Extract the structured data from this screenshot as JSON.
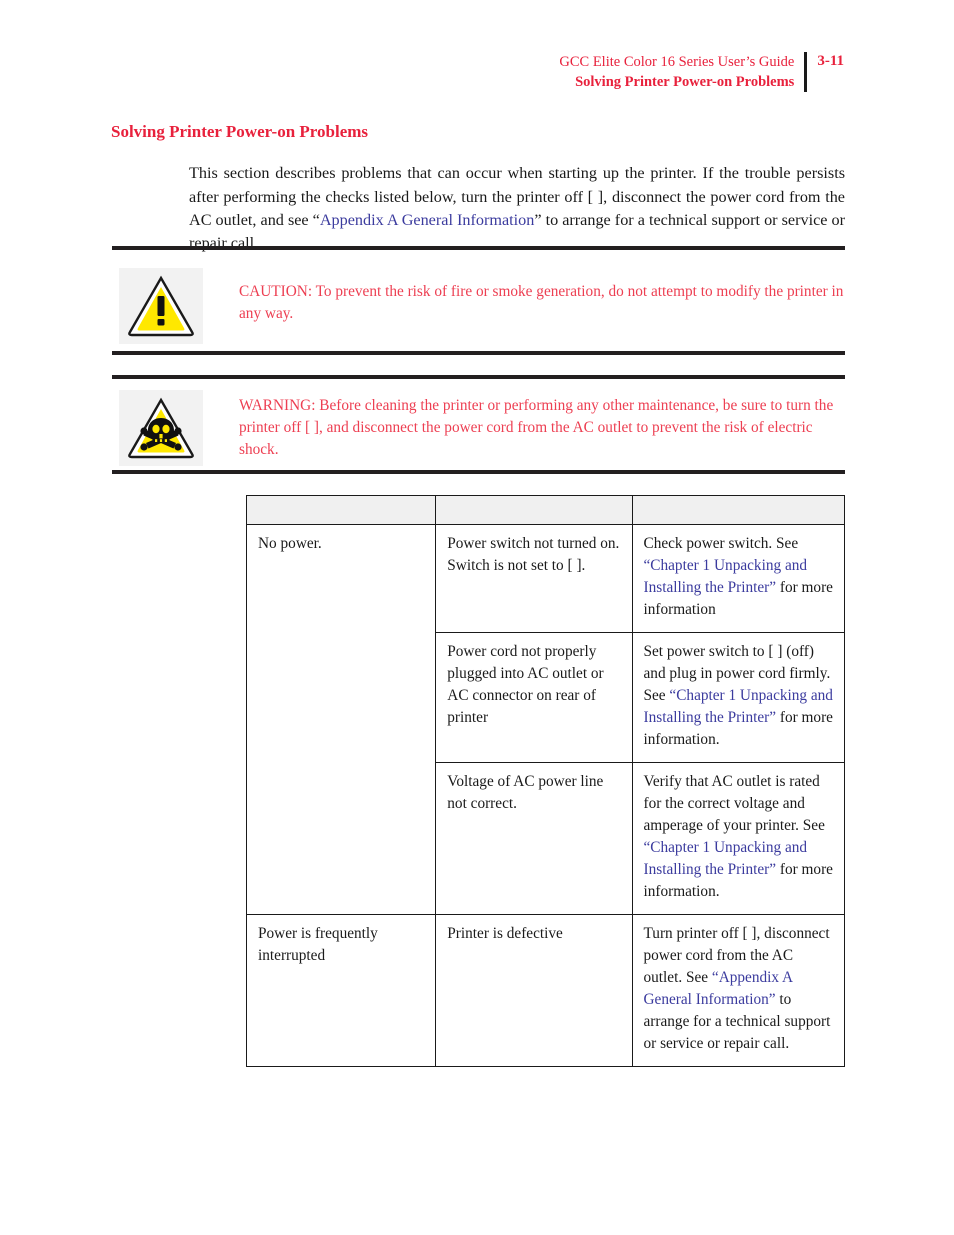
{
  "header": {
    "guide_title": "GCC Elite Color 16 Series User’s Guide",
    "section_title": "Solving Printer Power-on Problems",
    "page_number": "3-11"
  },
  "section": {
    "title": "Solving Printer Power-on Problems",
    "intro_part1": "This section describes problems that can occur when starting up the printer. If the trouble persists after performing the checks listed below, turn the printer off [    ], disconnect the power cord from the AC outlet, and see “",
    "intro_link": "Appendix A General Information",
    "intro_part2": "”  to arrange for a technical support or service or repair call."
  },
  "caution": {
    "icon": "warning-triangle-exclamation-icon",
    "text": "CAUTION: To prevent the risk of fire or smoke generation, do not attempt to modify the printer in any way."
  },
  "warning": {
    "icon": "warning-triangle-skull-icon",
    "text": "WARNING: Before cleaning the printer or performing any other maintenance, be sure to turn the printer off [     ], and disconnect the power cord from the AC outlet to prevent the risk of electric shock."
  },
  "table": {
    "headers": [
      "",
      "",
      ""
    ],
    "rows": [
      {
        "symptom": "No power.",
        "cause": "Power switch not turned on. Switch is not set to [   ].",
        "remedy_pre": "Check power switch. See ",
        "remedy_link": "“Chapter 1 Unpacking and Installing the Printer”",
        "remedy_post": " for more information"
      },
      {
        "symptom": "",
        "cause": "Power cord not properly plugged into AC outlet or AC connector on rear of printer",
        "remedy_pre": "Set power switch to [     ] (off) and plug in power cord firmly. See ",
        "remedy_link": "“Chapter 1 Unpacking and Installing the Printer”",
        "remedy_post": " for more information."
      },
      {
        "symptom": "",
        "cause": "Voltage of AC power line not correct.",
        "remedy_pre": "Verify that AC outlet is rated for the correct voltage and amperage of your printer. See ",
        "remedy_link": "“Chapter 1 Unpacking and Installing the Printer”",
        "remedy_post": " for more information."
      },
      {
        "symptom": "Power is frequently interrupted",
        "cause": "Printer is defective",
        "remedy_pre": "Turn printer off [     ], disconnect power cord from the AC outlet. See ",
        "remedy_link": "“Appendix A General Information”",
        "remedy_post": " to arrange for a technical support or service or repair call."
      }
    ]
  },
  "colors": {
    "heading_red": "#e8213c",
    "admonition_red": "#ed3f52",
    "link_blue": "#3b3b9e",
    "rule_black": "#231f20",
    "table_header_gray": "#f0f0f0",
    "icon_yellow": "#ffe800"
  }
}
